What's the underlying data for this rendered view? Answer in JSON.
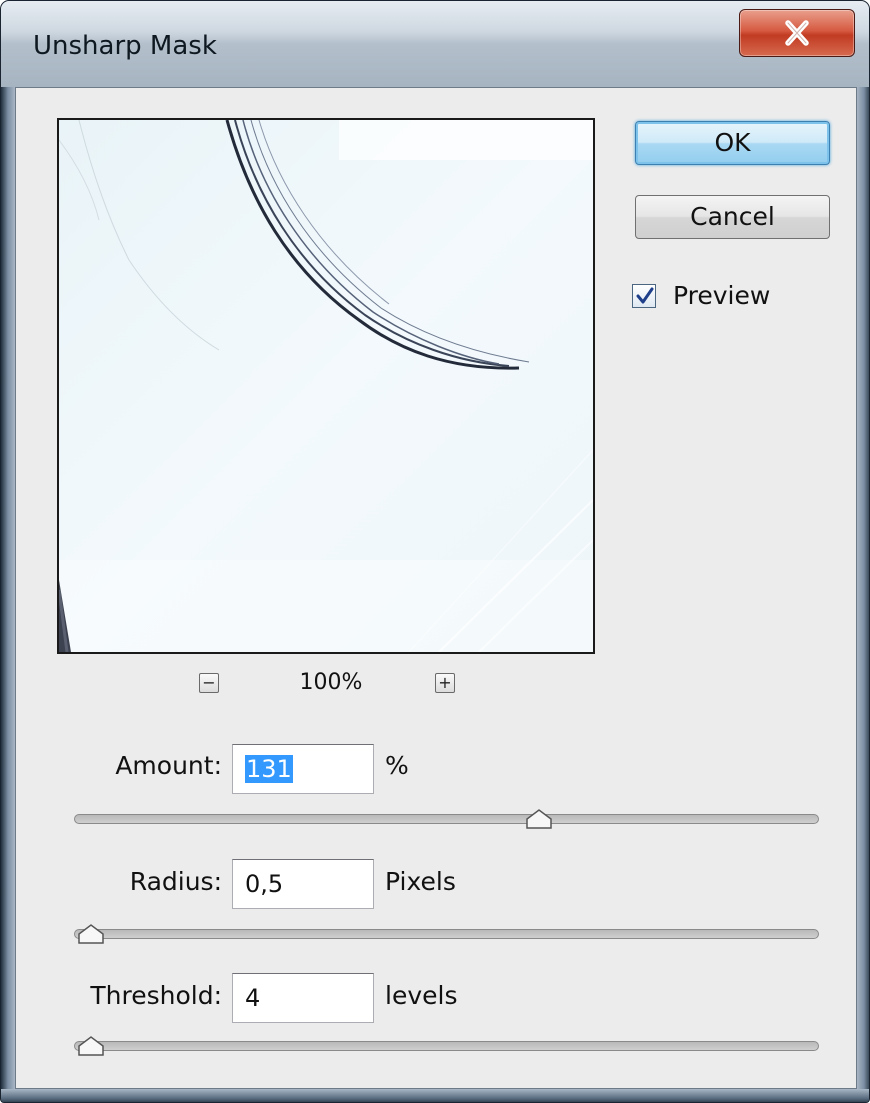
{
  "window": {
    "title": "Unsharp Mask",
    "close_icon": "close-x-icon"
  },
  "preview": {
    "zoom_level": "100%",
    "zoom_out_label": "−",
    "zoom_in_label": "+"
  },
  "buttons": {
    "ok": "OK",
    "cancel": "Cancel"
  },
  "preview_toggle": {
    "label": "Preview",
    "checked": true
  },
  "params": {
    "amount": {
      "label": "Amount:",
      "value": "131",
      "unit": "%",
      "slider_fraction": 0.628
    },
    "radius": {
      "label": "Radius:",
      "value": "0,5",
      "unit": "Pixels",
      "slider_fraction": 0.0
    },
    "threshold": {
      "label": "Threshold:",
      "value": "4",
      "unit": "levels",
      "slider_fraction": 0.0
    }
  }
}
